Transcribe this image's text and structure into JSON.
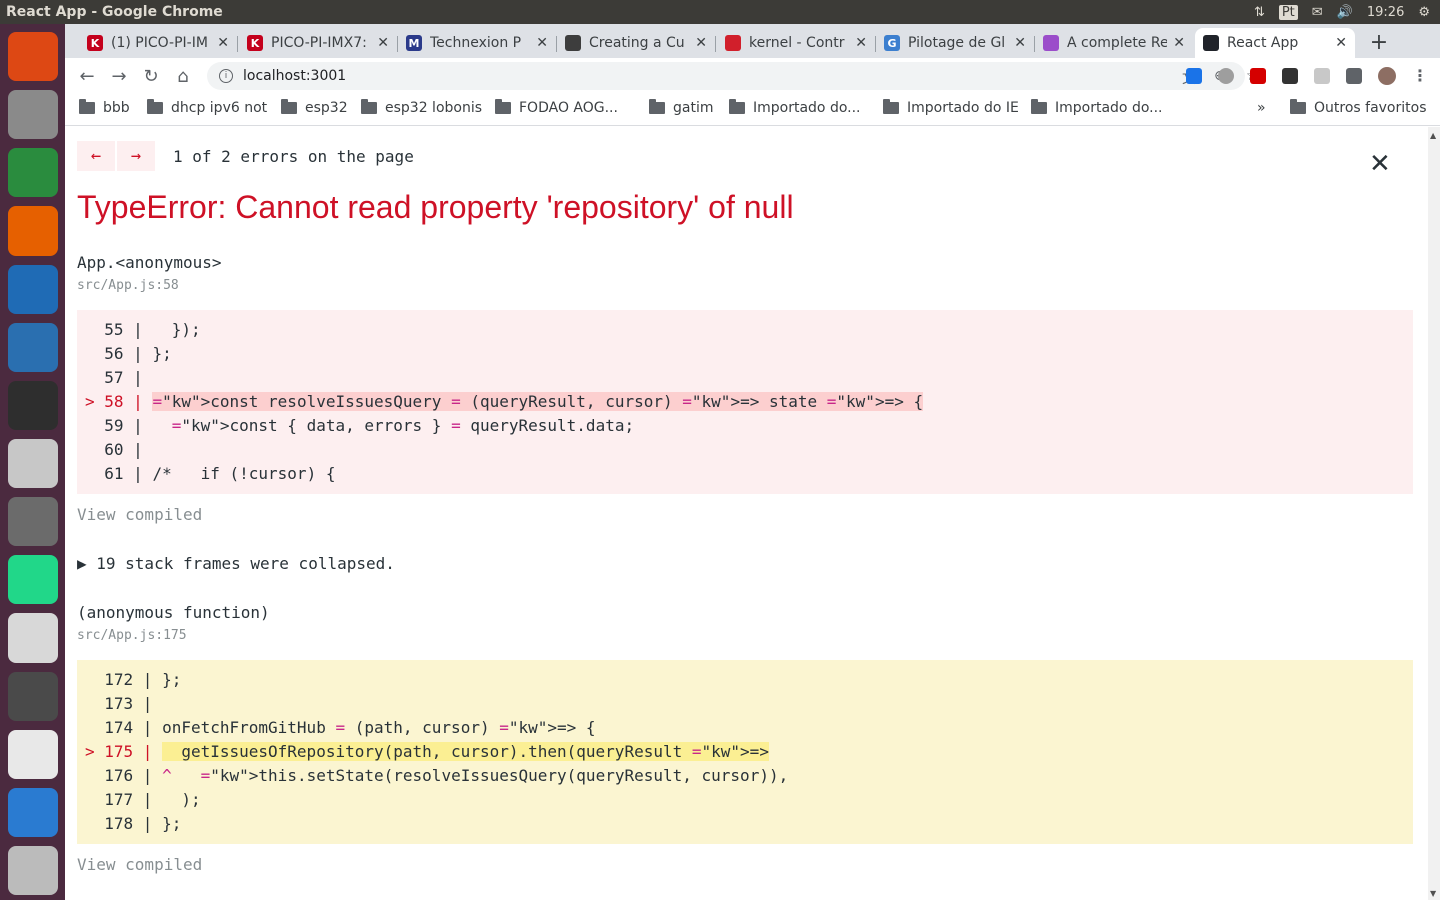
{
  "window": {
    "title": "React App - Google Chrome"
  },
  "tray": {
    "lang": "Pt",
    "time": "19:26"
  },
  "tabs": [
    {
      "title": "(1) PICO-PI-IM",
      "fav": "K",
      "color": "#c4001c"
    },
    {
      "title": "PICO-PI-IMX7:",
      "fav": "K",
      "color": "#c4001c"
    },
    {
      "title": "Technexion P",
      "fav": "M",
      "color": "#2b3a8a"
    },
    {
      "title": "Creating a Cu",
      "fav": "",
      "color": "#3d3d3d"
    },
    {
      "title": "kernel - Contr",
      "fav": "",
      "color": "#d11f2b"
    },
    {
      "title": "Pilotage de Gl",
      "fav": "G",
      "color": "#3c7fcf"
    },
    {
      "title": "A complete Re",
      "fav": "",
      "color": "#9b4dca"
    },
    {
      "title": "React App",
      "fav": "",
      "color": "#20232a",
      "active": true
    }
  ],
  "toolbar": {
    "url": "localhost:3001"
  },
  "bookmarks": [
    "bbb",
    "dhcp ipv6 not",
    "esp32",
    "esp32 lobonis",
    "FODAO  AOG...",
    "gatim",
    "Importado do...",
    "Importado do IE",
    "Importado do...",
    "Outros favoritos"
  ],
  "bookmarks_overflow": "»",
  "overlay": {
    "prev": "←",
    "next": "→",
    "count_text": "1 of 2 errors on the page",
    "close": "✕",
    "title": "TypeError: Cannot read property 'repository' of null",
    "frames": [
      {
        "function": "App.<anonymous>",
        "location": "src/App.js:58",
        "type": "red",
        "lines": [
          {
            "gutter": "  55 | ",
            "code": "  });",
            "hi": false
          },
          {
            "gutter": "  56 | ",
            "code": "};",
            "hi": false
          },
          {
            "gutter": "  57 | ",
            "code": "",
            "hi": false
          },
          {
            "gutter": "> 58 | ",
            "code": "const resolveIssuesQuery = (queryResult, cursor) => state => {",
            "hi": true
          },
          {
            "gutter": "  59 | ",
            "code": "  const { data, errors } = queryResult.data;",
            "hi": false
          },
          {
            "gutter": "  60 | ",
            "code": "",
            "hi": false
          },
          {
            "gutter": "  61 | ",
            "code": "/*   if (!cursor) {",
            "hi": false
          }
        ],
        "view_compiled": "View compiled"
      },
      {
        "function": "(anonymous function)",
        "location": "src/App.js:175",
        "type": "yellow",
        "lines": [
          {
            "gutter": "  172 | ",
            "code": "};",
            "hi": false
          },
          {
            "gutter": "  173 | ",
            "code": "",
            "hi": false
          },
          {
            "gutter": "  174 | ",
            "code": "onFetchFromGitHub = (path, cursor) => {",
            "hi": false
          },
          {
            "gutter": "> 175 | ",
            "code": "  getIssuesOfRepository(path, cursor).then(queryResult =>",
            "hi": true
          },
          {
            "gutter": "  176 | ",
            "code": "^   this.setState(resolveIssuesQuery(queryResult, cursor)),",
            "hi": false
          },
          {
            "gutter": "  177 | ",
            "code": "  );",
            "hi": false
          },
          {
            "gutter": "  178 | ",
            "code": "};",
            "hi": false
          }
        ],
        "view_compiled": "View compiled"
      }
    ],
    "collapsed_text": "▶ 19 stack frames were collapsed."
  },
  "launcher_apps": [
    {
      "name": "ubuntu-dash",
      "color": "#dd4814"
    },
    {
      "name": "files",
      "color": "#8a8a8a"
    },
    {
      "name": "chrome",
      "color": "#2a8c3e"
    },
    {
      "name": "firefox",
      "color": "#e66000"
    },
    {
      "name": "writer",
      "color": "#1f6bb5"
    },
    {
      "name": "thunderbird",
      "color": "#2a6fb0"
    },
    {
      "name": "terminal",
      "color": "#2e2e2e"
    },
    {
      "name": "software",
      "color": "#c7c7c7"
    },
    {
      "name": "settings",
      "color": "#6b6b6b"
    },
    {
      "name": "pycharm",
      "color": "#21d789"
    },
    {
      "name": "text-editor",
      "color": "#d8d8d8"
    },
    {
      "name": "updater",
      "color": "#4a4a4a"
    },
    {
      "name": "document-viewer",
      "color": "#e8e8e8"
    },
    {
      "name": "vscode",
      "color": "#2a7bd1"
    },
    {
      "name": "workspaces",
      "color": "#bbbbbb"
    }
  ]
}
